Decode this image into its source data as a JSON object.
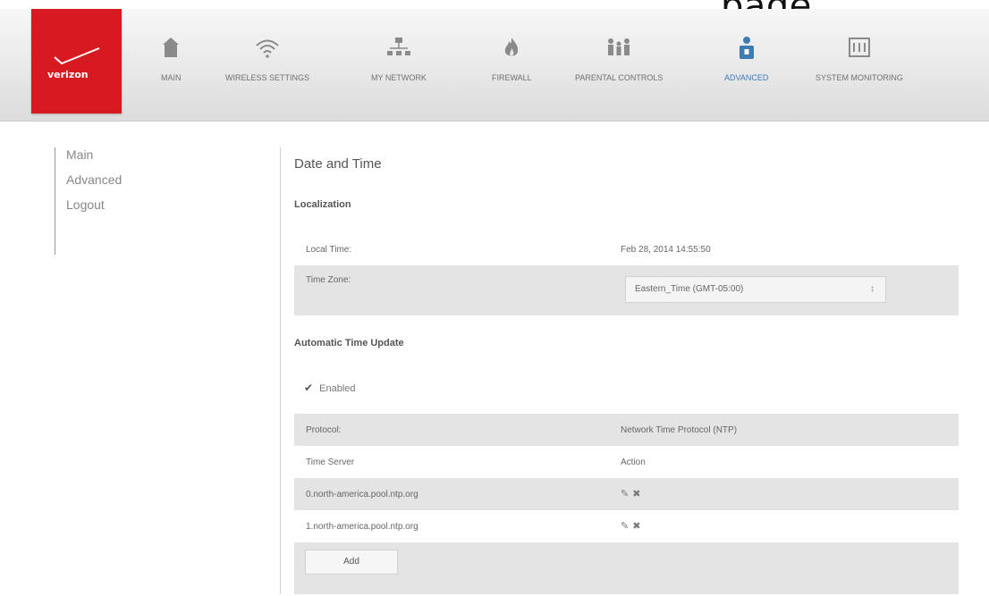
{
  "top_caption": "page",
  "brand": {
    "logo_text": "verizon",
    "accent_color": "#d71a21",
    "active_color": "#3d7bb6"
  },
  "nav": {
    "items": [
      {
        "label": "MAIN",
        "icon": "home-icon"
      },
      {
        "label": "WIRELESS SETTINGS",
        "icon": "wifi-icon"
      },
      {
        "label": "MY NETWORK",
        "icon": "network-icon"
      },
      {
        "label": "FIREWALL",
        "icon": "fire-icon"
      },
      {
        "label": "PARENTAL CONTROLS",
        "icon": "parental-icon"
      },
      {
        "label": "ADVANCED",
        "icon": "user-lock-icon",
        "active": true
      },
      {
        "label": "SYSTEM MONITORING",
        "icon": "monitor-icon"
      }
    ]
  },
  "sidebar": {
    "items": [
      "Main",
      "Advanced",
      "Logout"
    ]
  },
  "page": {
    "title": "Date and Time",
    "localization": {
      "heading": "Localization",
      "local_time_label": "Local Time:",
      "local_time_value": "Feb 28, 2014 14:55:50",
      "time_zone_label": "Time Zone:",
      "time_zone_value": "Eastern_Time (GMT-05:00)"
    },
    "auto_update": {
      "heading": "Automatic Time Update",
      "enabled_label": "Enabled",
      "enabled": true,
      "protocol_label": "Protocol:",
      "protocol_value": "Network Time Protocol (NTP)",
      "col_time_server": "Time Server",
      "col_action": "Action",
      "servers": [
        "0.north-america.pool.ntp.org",
        "1.north-america.pool.ntp.org"
      ],
      "add_label": "Add"
    }
  }
}
